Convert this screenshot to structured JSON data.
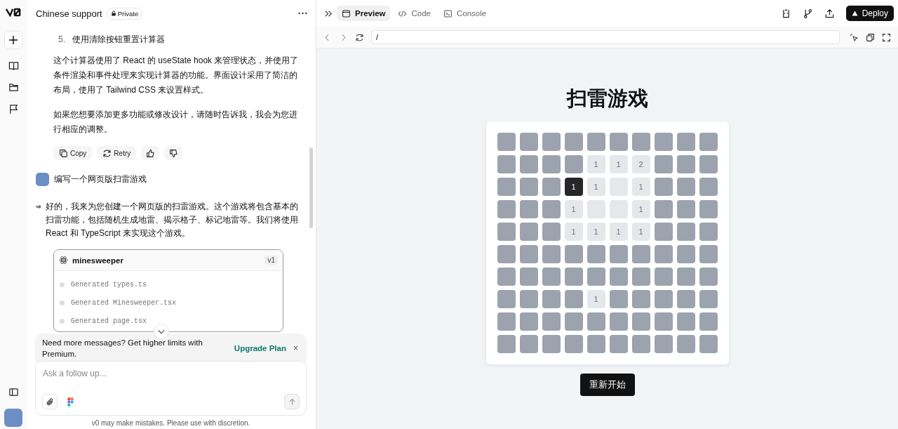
{
  "chat": {
    "title": "Chinese support",
    "visibility": "Private",
    "list_item": {
      "number": "5.",
      "text": "使用清除按钮重置计算器"
    },
    "paragraphs": [
      "这个计算器使用了 React 的 useState hook 来管理状态，并使用了条件渲染和事件处理来实现计算器的功能。界面设计采用了简洁的布局，使用了 Tailwind CSS 来设置样式。",
      "如果您想要添加更多功能或修改设计，请随时告诉我，我会为您进行相应的调整。"
    ],
    "actions": [
      {
        "kind": "copy",
        "label": "Copy"
      },
      {
        "kind": "retry",
        "label": "Retry"
      },
      {
        "kind": "like"
      },
      {
        "kind": "dislike"
      }
    ],
    "user_message": "编写一个网页版扫雷游戏",
    "assistant_message": "好的，我来为您创建一个网页版的扫雷游戏。这个游戏将包含基本的扫雷功能，包括随机生成地雷、揭示格子、标记地雷等。我们将使用 React 和 TypeScript 来实现这个游戏。",
    "artifact": {
      "title": "minesweeper",
      "version": "v1",
      "steps": [
        "Generated types.ts",
        "Generated Minesweeper.tsx",
        "Generated page.tsx"
      ]
    },
    "banner": {
      "text": "Need more messages? Get higher limits with Premium.",
      "link": "Upgrade Plan",
      "close": "×"
    },
    "composer": {
      "placeholder": "Ask a follow up..."
    },
    "disclaimer": "v0 may make mistakes. Please use with discretion."
  },
  "preview": {
    "tabs": [
      {
        "kind": "preview",
        "label": "Preview",
        "selected": true
      },
      {
        "kind": "code",
        "label": "Code",
        "selected": false
      },
      {
        "kind": "console",
        "label": "Console",
        "selected": false
      }
    ],
    "deploy": "Deploy",
    "url": "/",
    "game": {
      "title": "扫雷游戏",
      "restart": "重新开始",
      "rows": [
        [
          {
            "kind": "hidden"
          },
          {
            "kind": "hidden"
          },
          {
            "kind": "hidden"
          },
          {
            "kind": "hidden"
          },
          {
            "kind": "hidden"
          },
          {
            "kind": "hidden"
          },
          {
            "kind": "hidden"
          },
          {
            "kind": "hidden"
          },
          {
            "kind": "hidden"
          },
          {
            "kind": "hidden"
          }
        ],
        [
          {
            "kind": "hidden"
          },
          {
            "kind": "hidden"
          },
          {
            "kind": "hidden"
          },
          {
            "kind": "hidden"
          },
          {
            "kind": "revealed",
            "text": "1"
          },
          {
            "kind": "revealed",
            "text": "1"
          },
          {
            "kind": "revealed",
            "text": "2"
          },
          {
            "kind": "hidden"
          },
          {
            "kind": "hidden"
          },
          {
            "kind": "hidden"
          }
        ],
        [
          {
            "kind": "hidden"
          },
          {
            "kind": "hidden"
          },
          {
            "kind": "hidden"
          },
          {
            "kind": "active",
            "text": "1"
          },
          {
            "kind": "revealed",
            "text": "1"
          },
          {
            "kind": "revealed"
          },
          {
            "kind": "revealed",
            "text": "1"
          },
          {
            "kind": "hidden"
          },
          {
            "kind": "hidden"
          },
          {
            "kind": "hidden"
          }
        ],
        [
          {
            "kind": "hidden"
          },
          {
            "kind": "hidden"
          },
          {
            "kind": "hidden"
          },
          {
            "kind": "revealed",
            "text": "1"
          },
          {
            "kind": "revealed"
          },
          {
            "kind": "revealed"
          },
          {
            "kind": "revealed",
            "text": "1"
          },
          {
            "kind": "hidden"
          },
          {
            "kind": "hidden"
          },
          {
            "kind": "hidden"
          }
        ],
        [
          {
            "kind": "hidden"
          },
          {
            "kind": "hidden"
          },
          {
            "kind": "hidden"
          },
          {
            "kind": "revealed",
            "text": "1"
          },
          {
            "kind": "revealed",
            "text": "1"
          },
          {
            "kind": "revealed",
            "text": "1"
          },
          {
            "kind": "revealed",
            "text": "1"
          },
          {
            "kind": "hidden"
          },
          {
            "kind": "hidden"
          },
          {
            "kind": "hidden"
          }
        ],
        [
          {
            "kind": "hidden"
          },
          {
            "kind": "hidden"
          },
          {
            "kind": "hidden"
          },
          {
            "kind": "hidden"
          },
          {
            "kind": "hidden"
          },
          {
            "kind": "hidden"
          },
          {
            "kind": "hidden"
          },
          {
            "kind": "hidden"
          },
          {
            "kind": "hidden"
          },
          {
            "kind": "hidden"
          }
        ],
        [
          {
            "kind": "hidden"
          },
          {
            "kind": "hidden"
          },
          {
            "kind": "hidden"
          },
          {
            "kind": "hidden"
          },
          {
            "kind": "hidden"
          },
          {
            "kind": "hidden"
          },
          {
            "kind": "hidden"
          },
          {
            "kind": "hidden"
          },
          {
            "kind": "hidden"
          },
          {
            "kind": "hidden"
          }
        ],
        [
          {
            "kind": "hidden"
          },
          {
            "kind": "hidden"
          },
          {
            "kind": "hidden"
          },
          {
            "kind": "hidden"
          },
          {
            "kind": "revealed",
            "text": "1"
          },
          {
            "kind": "hidden"
          },
          {
            "kind": "hidden"
          },
          {
            "kind": "hidden"
          },
          {
            "kind": "hidden"
          },
          {
            "kind": "hidden"
          }
        ],
        [
          {
            "kind": "hidden"
          },
          {
            "kind": "hidden"
          },
          {
            "kind": "hidden"
          },
          {
            "kind": "hidden"
          },
          {
            "kind": "hidden"
          },
          {
            "kind": "hidden"
          },
          {
            "kind": "hidden"
          },
          {
            "kind": "hidden"
          },
          {
            "kind": "hidden"
          },
          {
            "kind": "hidden"
          }
        ],
        [
          {
            "kind": "hidden"
          },
          {
            "kind": "hidden"
          },
          {
            "kind": "hidden"
          },
          {
            "kind": "hidden"
          },
          {
            "kind": "hidden"
          },
          {
            "kind": "hidden"
          },
          {
            "kind": "hidden"
          },
          {
            "kind": "hidden"
          },
          {
            "kind": "hidden"
          },
          {
            "kind": "hidden"
          }
        ]
      ]
    }
  }
}
